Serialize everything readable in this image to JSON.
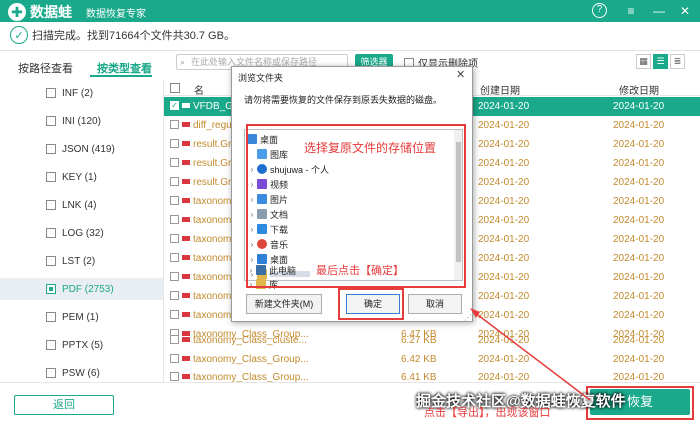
{
  "app": {
    "logo_text": "数据蛙",
    "subtitle": "数据恢复专家",
    "help_icon": "?",
    "menu_icon": "≡",
    "minimize_icon": "—",
    "close_icon": "✕"
  },
  "status": {
    "text": "扫描完成。找到71664个文件共30.7 GB。"
  },
  "tabs": {
    "by_path": "按路径查看",
    "by_type": "按类型查看"
  },
  "toolbar": {
    "search_placeholder": "在此处输入文件名称或保存路径",
    "filter_label": "筛选器",
    "only_deleted_label": "仅显示删除项"
  },
  "sidebar": {
    "items": [
      {
        "label": "INF (2)"
      },
      {
        "label": "INI (120)"
      },
      {
        "label": "JSON (419)"
      },
      {
        "label": "KEY (1)"
      },
      {
        "label": "LNK (4)"
      },
      {
        "label": "LOG (32)"
      },
      {
        "label": "LST (2)"
      },
      {
        "label": "PDF (2753)"
      },
      {
        "label": "PEM (1)"
      },
      {
        "label": "PPTX (5)"
      },
      {
        "label": "PSW (6)"
      }
    ]
  },
  "list": {
    "col_name": "名",
    "col_created": "创建日期",
    "col_modified": "修改日期",
    "rows": [
      {
        "name": "VFDB_Gro",
        "size": "",
        "created": "2024-01-20",
        "modified": "2024-01-20"
      },
      {
        "name": "diff_regula",
        "size": "",
        "created": "2024-01-20",
        "modified": "2024-01-20"
      },
      {
        "name": "result.Gro",
        "size": "",
        "created": "2024-01-20",
        "modified": "2024-01-20"
      },
      {
        "name": "result.Gro",
        "size": "",
        "created": "2024-01-20",
        "modified": "2024-01-20"
      },
      {
        "name": "result.Gro",
        "size": "",
        "created": "2024-01-20",
        "modified": "2024-01-20"
      },
      {
        "name": "taxonomy",
        "size": "",
        "created": "2024-01-20",
        "modified": "2024-01-20"
      },
      {
        "name": "taxonomy",
        "size": "",
        "created": "2024-01-20",
        "modified": "2024-01-20"
      },
      {
        "name": "taxonomy",
        "size": "",
        "created": "2024-01-20",
        "modified": "2024-01-20"
      },
      {
        "name": "taxonomy",
        "size": "",
        "created": "2024-01-20",
        "modified": "2024-01-20"
      },
      {
        "name": "taxonomy",
        "size": "",
        "created": "2024-01-20",
        "modified": "2024-01-20"
      },
      {
        "name": "taxonomy",
        "size": "",
        "created": "2024-01-20",
        "modified": "2024-01-20"
      },
      {
        "name": "taxonomy",
        "size": "",
        "created": "2024-01-20",
        "modified": "2024-01-20"
      },
      {
        "name": "taxonomy_Class_Group...",
        "size": "6.47 KB",
        "created": "2024-01-20",
        "modified": "2024-01-20"
      },
      {
        "name": "taxonomy_Class_cluste...",
        "size": "6.27 KB",
        "created": "2024-01-20",
        "modified": "2024-01-20"
      },
      {
        "name": "taxonomy_Class_Group...",
        "size": "6.42 KB",
        "created": "2024-01-20",
        "modified": "2024-01-20"
      },
      {
        "name": "taxonomy_Class_Group...",
        "size": "6.41 KB",
        "created": "2024-01-20",
        "modified": "2024-01-20"
      }
    ]
  },
  "dialog": {
    "title": "浏览文件夹",
    "description": "请勿将需要恢复的文件保存到原丢失数据的磁盘。",
    "tree": [
      {
        "label": "桌面",
        "color": "#3a86d9"
      },
      {
        "label": "图库",
        "color": "#4a9be8"
      },
      {
        "label": "shujuwa - 个人",
        "color": "#1f6fd1"
      },
      {
        "label": "视频",
        "color": "#7b4bd6"
      },
      {
        "label": "图片",
        "color": "#3c8be0"
      },
      {
        "label": "文档",
        "color": "#8a9bb0"
      },
      {
        "label": "下载",
        "color": "#2d8ae0"
      },
      {
        "label": "音乐",
        "color": "#e0473c"
      },
      {
        "label": "桌面",
        "color": "#2f7ed8"
      },
      {
        "label": "",
        "color": "#e0b64a"
      },
      {
        "label": "此电脑",
        "color": "#3b6fa8"
      },
      {
        "label": "库",
        "color": "#e0b64a"
      }
    ],
    "new_folder": "新建文件夹(M)",
    "ok": "确定",
    "cancel": "取消",
    "close_icon": "✕"
  },
  "annotations": {
    "top": "选择复原文件的存储位置",
    "middle": "最后点击【确定】",
    "bottom": "点击【导出】，出现该窗口"
  },
  "bottom": {
    "back": "返回",
    "recover": "恢复",
    "watermark": "掘金技术社区@数据蛙恢复软件"
  },
  "colors": {
    "brand": "#1aa98a",
    "annotation": "#e63b3b",
    "file_text": "#c38a2e"
  }
}
